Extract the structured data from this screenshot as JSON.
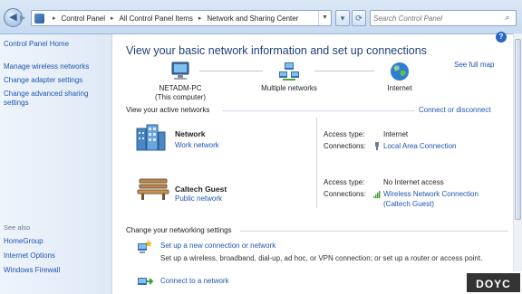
{
  "address_bar": {
    "breadcrumbs": [
      "Control Panel",
      "All Control Panel Items",
      "Network and Sharing Center"
    ],
    "search_placeholder": "Search Control Panel"
  },
  "left_pane": {
    "home": "Control Panel Home",
    "links": [
      "Manage wireless networks",
      "Change adapter settings",
      "Change advanced sharing settings"
    ],
    "see_also_heading": "See also",
    "see_also": [
      "HomeGroup",
      "Internet Options",
      "Windows Firewall"
    ]
  },
  "main": {
    "headline": "View your basic network information and set up connections",
    "see_full_map": "See full map",
    "map": {
      "computer_name": "NETADM-PC",
      "computer_caption": "(This computer)",
      "middle": "Multiple networks",
      "end": "Internet"
    },
    "active_title": "View your active networks",
    "connect_disconnect": "Connect or disconnect",
    "networks": [
      {
        "name": "Network",
        "type": "Work network",
        "access_label": "Access type:",
        "access_value": "Internet",
        "connections_label": "Connections:",
        "connection": "Local Area Connection"
      },
      {
        "name": "Caltech Guest",
        "type": "Public network",
        "access_label": "Access type:",
        "access_value": "No Internet access",
        "connections_label": "Connections:",
        "connection_line1": "Wireless Network Connection",
        "connection_line2": "(Caltech Guest)"
      }
    ],
    "change_title": "Change your networking settings",
    "tasks": [
      {
        "link": "Set up a new connection or network",
        "desc": "Set up a wireless, broadband, dial-up, ad hoc, or VPN connection; or set up a router or access point."
      },
      {
        "link": "Connect to a network"
      }
    ]
  },
  "watermark": "DOYC"
}
